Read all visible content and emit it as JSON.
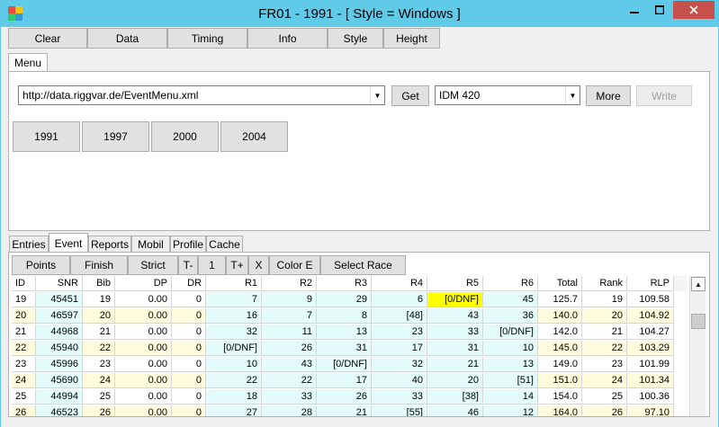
{
  "window": {
    "title": "FR01 - 1991 - [ Style = Windows ]",
    "icons": {
      "app": "app-icon",
      "min": "minimize-icon",
      "max": "maximize-icon",
      "close": "close-icon"
    }
  },
  "toolbar": [
    "Clear",
    "Data",
    "Timing",
    "Info",
    "Style",
    "Height"
  ],
  "top_tab": "Menu",
  "menu": {
    "url": "http://data.riggvar.de/EventMenu.xml",
    "get_label": "Get",
    "event": "IDM 420",
    "more_label": "More",
    "write_label": "Write",
    "years": [
      "1991",
      "1997",
      "2000",
      "2004"
    ]
  },
  "bottom_tabs": [
    "Entries",
    "Event",
    "Reports",
    "Mobil",
    "Profile",
    "Cache"
  ],
  "active_bottom_tab": "Event",
  "event_toolbar": [
    "Points",
    "Finish",
    "Strict",
    "T-",
    "1",
    "T+",
    "X",
    "Color E",
    "Select Race"
  ],
  "table": {
    "columns": [
      "ID",
      "SNR",
      "Bib",
      "DP",
      "DR",
      "R1",
      "R2",
      "R3",
      "R4",
      "R5",
      "R6",
      "Total",
      "Rank",
      "RLP"
    ],
    "rows": [
      [
        "19",
        "45451",
        "19",
        "0.00",
        "0",
        "7",
        "9",
        "29",
        "6",
        "[0/DNF]",
        "45",
        "125.7",
        "19",
        "109.58"
      ],
      [
        "20",
        "46597",
        "20",
        "0.00",
        "0",
        "16",
        "7",
        "8",
        "[48]",
        "43",
        "36",
        "140.0",
        "20",
        "104.92"
      ],
      [
        "21",
        "44968",
        "21",
        "0.00",
        "0",
        "32",
        "11",
        "13",
        "23",
        "33",
        "[0/DNF]",
        "142.0",
        "21",
        "104.27"
      ],
      [
        "22",
        "45940",
        "22",
        "0.00",
        "0",
        "[0/DNF]",
        "26",
        "31",
        "17",
        "31",
        "10",
        "145.0",
        "22",
        "103.29"
      ],
      [
        "23",
        "45996",
        "23",
        "0.00",
        "0",
        "10",
        "43",
        "[0/DNF]",
        "32",
        "21",
        "13",
        "149.0",
        "23",
        "101.99"
      ],
      [
        "24",
        "45690",
        "24",
        "0.00",
        "0",
        "22",
        "22",
        "17",
        "40",
        "20",
        "[51]",
        "151.0",
        "24",
        "101.34"
      ],
      [
        "25",
        "44994",
        "25",
        "0.00",
        "0",
        "18",
        "33",
        "26",
        "33",
        "[38]",
        "14",
        "154.0",
        "25",
        "100.36"
      ],
      [
        "26",
        "46523",
        "26",
        "0.00",
        "0",
        "27",
        "28",
        "21",
        "[55]",
        "46",
        "12",
        "164.0",
        "26",
        "97.10"
      ]
    ],
    "colors": {
      "cyan": "#e4fbfb",
      "yellow": "#fffbdc",
      "highlight": "#ffff00",
      "white": "#ffffff"
    }
  }
}
